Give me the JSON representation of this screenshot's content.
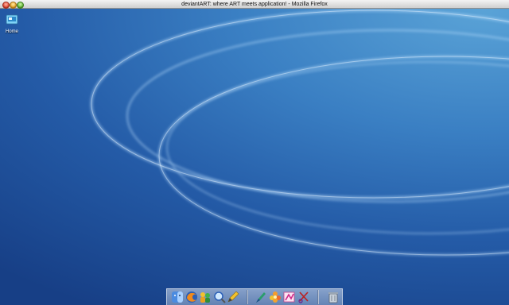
{
  "window": {
    "title": "deviantART: where ART meets application! - Mozilla Firefox",
    "buttons": [
      "close",
      "minimize",
      "zoom"
    ]
  },
  "desktop": {
    "icons": [
      {
        "label": "Home",
        "icon": "home-folder-icon"
      }
    ]
  },
  "dock": {
    "items": [
      {
        "icon": "finder-icon"
      },
      {
        "icon": "firefox-icon"
      },
      {
        "icon": "people-icon"
      },
      {
        "icon": "search-icon"
      },
      {
        "icon": "pencil-icon"
      },
      {
        "icon": "brush-icon"
      },
      {
        "icon": "flower-icon"
      },
      {
        "icon": "paint-icon"
      },
      {
        "icon": "scissors-icon"
      },
      {
        "icon": "trash-icon"
      }
    ]
  },
  "colors": {
    "desktop_light": "#5aa3d7",
    "desktop_dark": "#173f86"
  }
}
